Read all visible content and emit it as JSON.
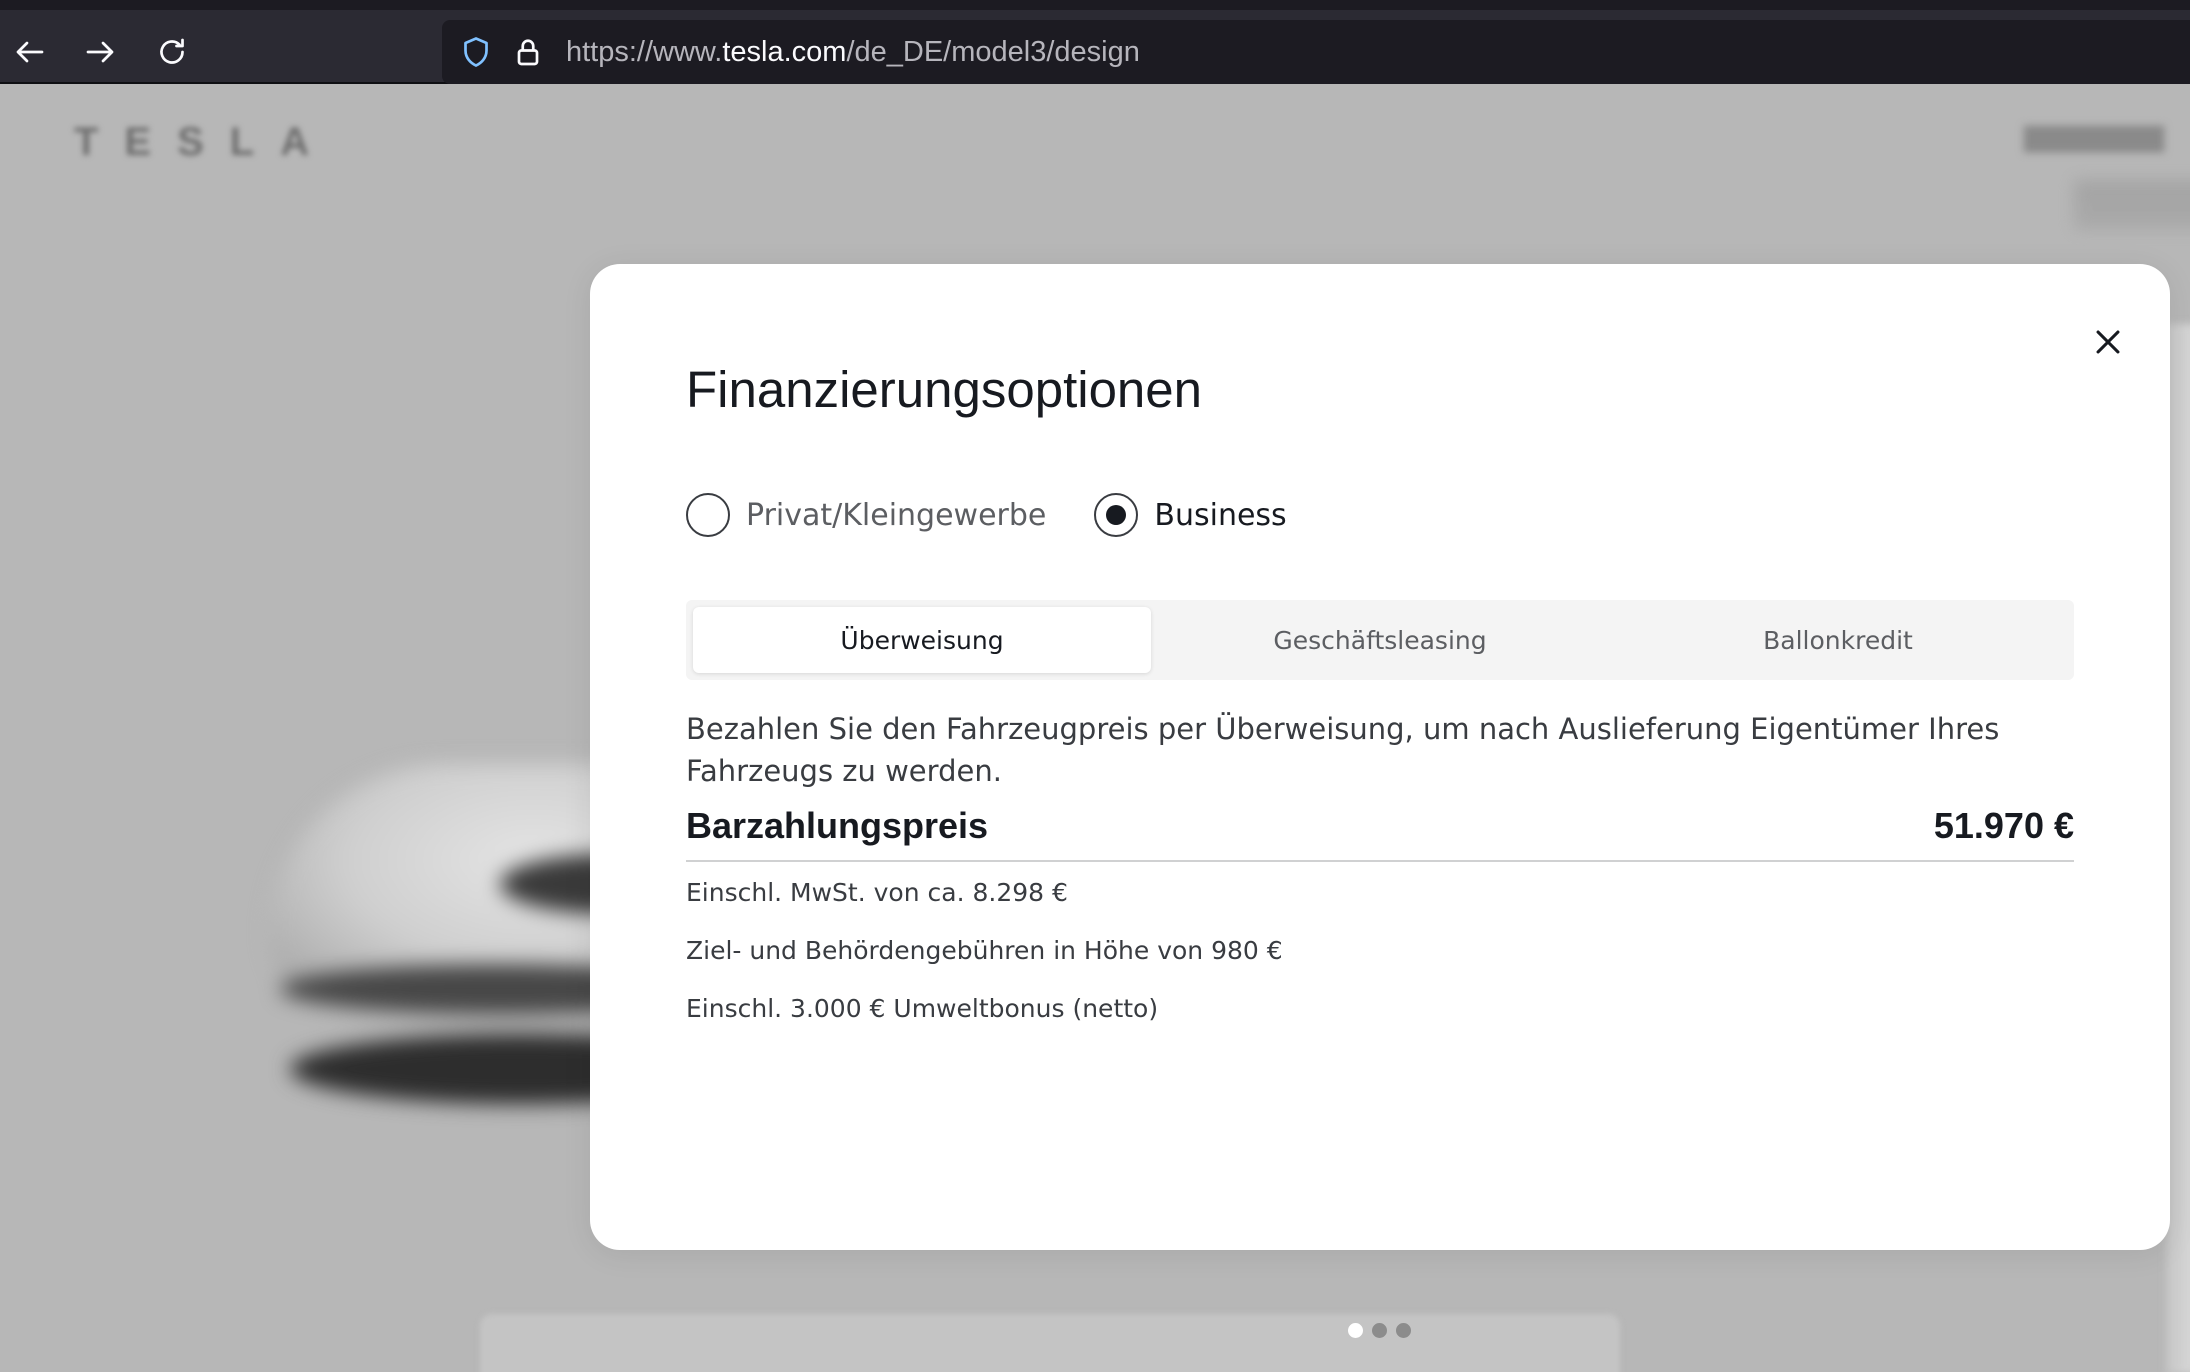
{
  "browser": {
    "url_scheme": "https://www.",
    "url_host": "tesla.com",
    "url_path": "/de_DE/model3/design"
  },
  "modal": {
    "title": "Finanzierungsoptionen",
    "customer_types": [
      {
        "label": "Privat/Kleingewerbe",
        "selected": false
      },
      {
        "label": "Business",
        "selected": true
      }
    ],
    "tabs": [
      {
        "label": "Überweisung",
        "active": true
      },
      {
        "label": "Geschäftsleasing",
        "active": false
      },
      {
        "label": "Ballonkredit",
        "active": false
      }
    ],
    "description": "Bezahlen Sie den Fahrzeugpreis per Überweisung, um nach Auslieferung Eigentümer Ihres Fahrzeugs zu werden.",
    "price_label": "Barzahlungspreis",
    "price_value": "51.970 €",
    "notes": [
      "Einschl. MwSt. von ca. 8.298 €",
      "Ziel- und Behördengebühren in Höhe von 980 €",
      "Einschl. 3.000 € Umweltbonus (netto)"
    ]
  },
  "carousel": {
    "total": 3,
    "active_index": 0
  }
}
